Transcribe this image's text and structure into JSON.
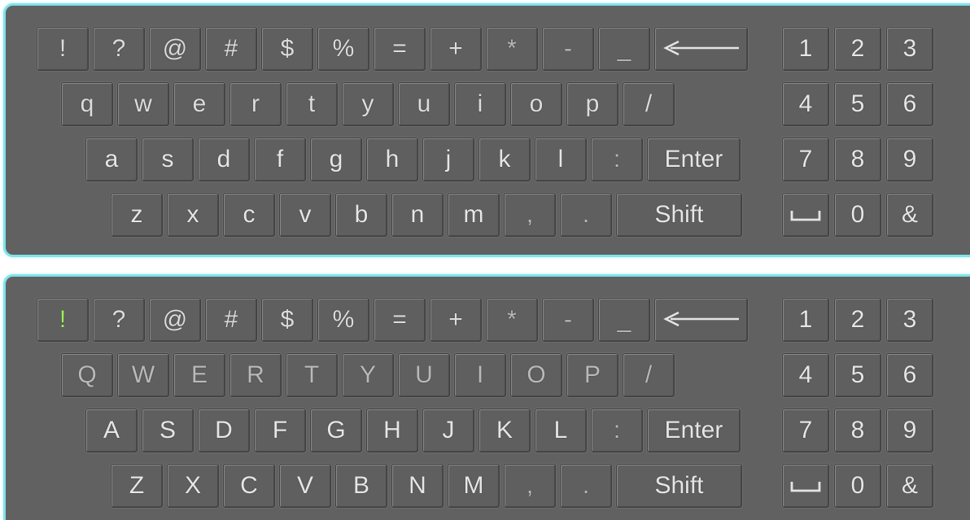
{
  "lower_keyboard": {
    "row1": [
      "!",
      "?",
      "@",
      "#",
      "$",
      "%",
      "=",
      "+",
      "*",
      "-",
      "_"
    ],
    "row2": [
      "q",
      "w",
      "e",
      "r",
      "t",
      "y",
      "u",
      "i",
      "o",
      "p",
      "/"
    ],
    "row3": [
      "a",
      "s",
      "d",
      "f",
      "g",
      "h",
      "j",
      "k",
      "l",
      ":"
    ],
    "row3_enter": "Enter",
    "row4": [
      "z",
      "x",
      "c",
      "v",
      "b",
      "n",
      "m",
      ",",
      "."
    ],
    "row4_shift": "Shift",
    "numpad": [
      [
        "1",
        "2",
        "3"
      ],
      [
        "4",
        "5",
        "6"
      ],
      [
        "7",
        "8",
        "9"
      ],
      [
        "",
        "0",
        "&"
      ]
    ]
  },
  "upper_keyboard": {
    "row1": [
      "!",
      "?",
      "@",
      "#",
      "$",
      "%",
      "=",
      "+",
      "*",
      "-",
      "_"
    ],
    "row2": [
      "Q",
      "W",
      "E",
      "R",
      "T",
      "Y",
      "U",
      "I",
      "O",
      "P",
      "/"
    ],
    "row3": [
      "A",
      "S",
      "D",
      "F",
      "G",
      "H",
      "J",
      "K",
      "L",
      ":"
    ],
    "row3_enter": "Enter",
    "row4": [
      "Z",
      "X",
      "C",
      "V",
      "B",
      "N",
      "M",
      ",",
      "."
    ],
    "row4_shift": "Shift",
    "numpad": [
      [
        "1",
        "2",
        "3"
      ],
      [
        "4",
        "5",
        "6"
      ],
      [
        "7",
        "8",
        "9"
      ],
      [
        "",
        "0",
        "&"
      ]
    ],
    "highlighted_key": "!"
  },
  "icons": {
    "backspace": "left-arrow-icon",
    "space": "space-bar-icon"
  },
  "colors": {
    "panel_bg": "#616161",
    "panel_border": "#7fe3ea",
    "key_text": "#dcdcdc",
    "highlight": "#9df05a"
  }
}
